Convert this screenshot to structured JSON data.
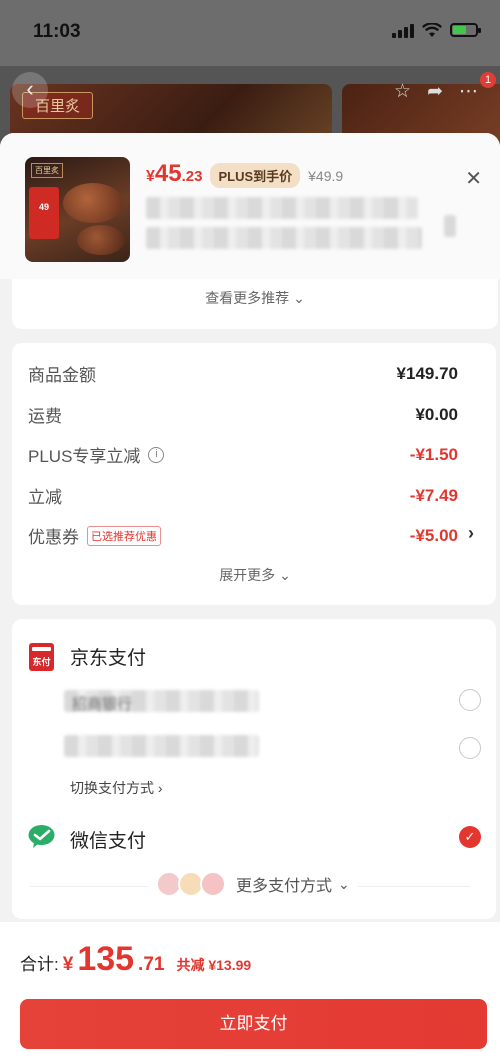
{
  "status_bar": {
    "time": "11:03"
  },
  "background": {
    "store_title": "百里炙"
  },
  "product": {
    "thumb_label": "百里炙",
    "thumb_badge": "49",
    "price_currency": "¥",
    "price_int": "45",
    "price_dec": ".23",
    "plus_tag": "PLUS到手价",
    "original_price": "¥49.9",
    "more_recommend": "查看更多推荐"
  },
  "fees": {
    "rows": [
      {
        "label": "商品金额",
        "value": "¥149.70"
      },
      {
        "label": "运费",
        "value": "¥0.00"
      },
      {
        "label": "PLUS专享立减",
        "value": "-¥1.50"
      },
      {
        "label": "立减",
        "value": "-¥7.49"
      },
      {
        "label": "优惠券",
        "value": "-¥5.00",
        "tag": "已选推荐优惠"
      }
    ],
    "expand": "展开更多"
  },
  "payment": {
    "jd_title": "京东支付",
    "jd_icon_text": "东付",
    "bank_visible": "招商银行",
    "switch": "切换支付方式",
    "wechat_title": "微信支付",
    "more_methods": "更多支付方式"
  },
  "footer": {
    "total_label": "合计:",
    "currency": "¥",
    "total_int": "135",
    "total_dec": ".71",
    "saved": "共减 ¥13.99",
    "pay_button": "立即支付"
  },
  "colors": {
    "accent": "#e2362f",
    "plus_tag_bg": "#f2dfc5",
    "wechat": "#2aae67"
  }
}
